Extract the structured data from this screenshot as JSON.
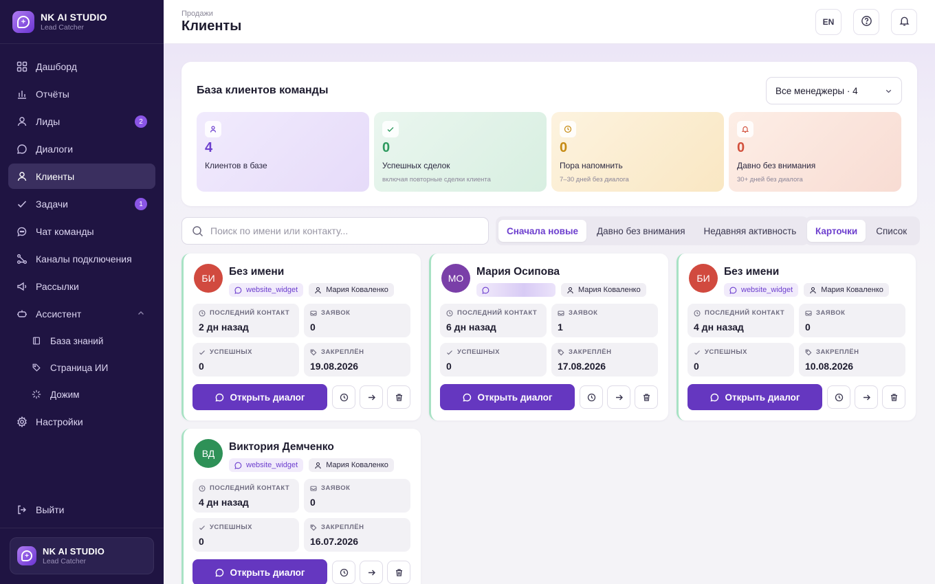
{
  "brand": {
    "name": "NK AI STUDIO",
    "sub": "Lead Catcher"
  },
  "nav": {
    "items": [
      {
        "label": "Дашборд",
        "icon": "dashboard-icon"
      },
      {
        "label": "Отчёты",
        "icon": "chart-icon"
      },
      {
        "label": "Лиды",
        "icon": "user-icon",
        "badge": "2"
      },
      {
        "label": "Диалоги",
        "icon": "chat-icon"
      },
      {
        "label": "Клиенты",
        "icon": "user-icon",
        "active": true
      },
      {
        "label": "Задачи",
        "icon": "check-icon",
        "badge": "1"
      },
      {
        "label": "Чат команды",
        "icon": "team-chat-icon"
      },
      {
        "label": "Каналы подключения",
        "icon": "link-icon"
      },
      {
        "label": "Рассылки",
        "icon": "megaphone-icon"
      },
      {
        "label": "Ассистент",
        "icon": "robot-icon"
      }
    ],
    "sub_items": [
      {
        "label": "База знаний",
        "icon": "book-icon"
      },
      {
        "label": "Страница ИИ",
        "icon": "tag-icon"
      },
      {
        "label": "Дожим",
        "icon": "spinner-icon"
      }
    ],
    "settings": "Настройки",
    "logout": "Выйти"
  },
  "header": {
    "breadcrumb": "Продажи",
    "title": "Клиенты",
    "lang": "EN"
  },
  "panel": {
    "title": "База клиентов команды",
    "manager_select": "Все менеджеры · 4",
    "stats": [
      {
        "value": "4",
        "label": "Клиентов в базе",
        "note": "",
        "color": "#6d3fce"
      },
      {
        "value": "0",
        "label": "Успешных сделок",
        "note": "включая повторные сделки клиента",
        "color": "#2e9a5f"
      },
      {
        "value": "0",
        "label": "Пора напомнить",
        "note": "7–30 дней без диалога",
        "color": "#c58a12"
      },
      {
        "value": "0",
        "label": "Давно без внимания",
        "note": "30+ дней без диалога",
        "color": "#d2503c"
      }
    ]
  },
  "search": {
    "placeholder": "Поиск по имени или контакту..."
  },
  "sort_tabs": [
    "Сначала новые",
    "Давно без внимания",
    "Недавняя активность"
  ],
  "view_tabs": [
    "Карточки",
    "Список"
  ],
  "labels": {
    "last_contact": "ПОСЛЕДНИЙ КОНТАКТ",
    "requests": "ЗАЯВОК",
    "successful": "УСПЕШНЫХ",
    "assigned": "ЗАКРЕПЛЁН",
    "open_dialog": "Открыть диалог"
  },
  "clients": [
    {
      "initials": "БИ",
      "name": "Без имени",
      "source": "website_widget",
      "manager": "Мария Коваленко",
      "last_contact": "2 дн назад",
      "requests": "0",
      "successful": "0",
      "assigned": "19.08.2026",
      "avatar_color": "#d14a3f"
    },
    {
      "initials": "МО",
      "name": "Мария Осипова",
      "source": "",
      "manager": "Мария Коваленко",
      "last_contact": "6 дн назад",
      "requests": "1",
      "successful": "0",
      "assigned": "17.08.2026",
      "avatar_color": "#7a3fa8"
    },
    {
      "initials": "БИ",
      "name": "Без имени",
      "source": "website_widget",
      "manager": "Мария Коваленко",
      "last_contact": "4 дн назад",
      "requests": "0",
      "successful": "0",
      "assigned": "10.08.2026",
      "avatar_color": "#d14a3f"
    },
    {
      "initials": "ВД",
      "name": "Виктория Демченко",
      "source": "website_widget",
      "manager": "Мария Коваленко",
      "last_contact": "4 дн назад",
      "requests": "0",
      "successful": "0",
      "assigned": "16.07.2026",
      "avatar_color": "#2e9157"
    }
  ]
}
